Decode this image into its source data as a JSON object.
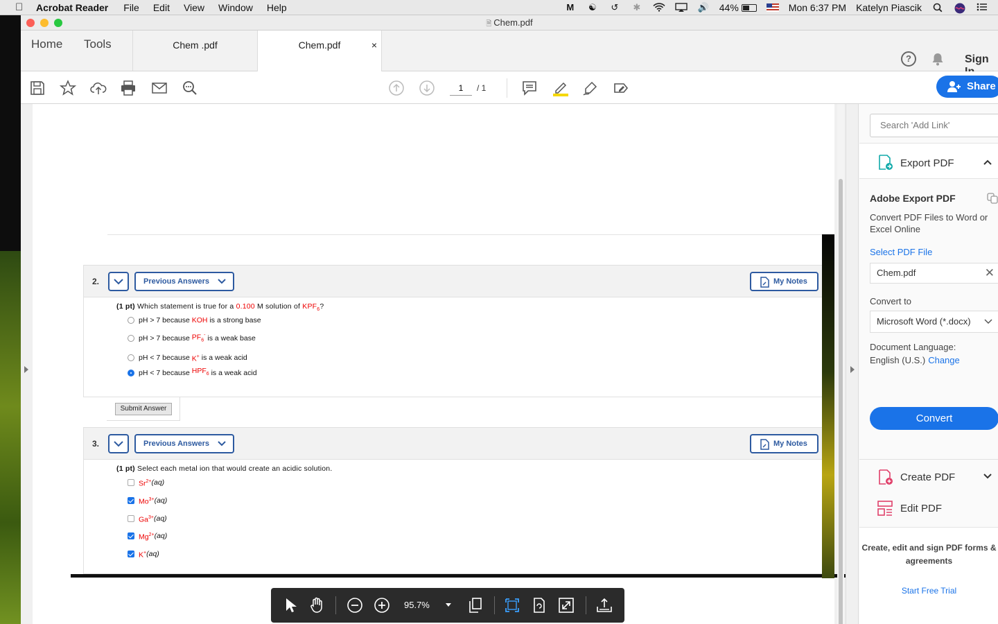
{
  "menubar": {
    "app_name": "Acrobat Reader",
    "menus": [
      "File",
      "Edit",
      "View",
      "Window",
      "Help"
    ],
    "battery": "44%",
    "clock": "Mon 6:37 PM",
    "user": "Katelyn Piascik"
  },
  "window": {
    "title": "Chem.pdf"
  },
  "tabs": {
    "home": "Home",
    "tools": "Tools",
    "doc_tabs": [
      {
        "label": "Chem .pdf"
      },
      {
        "label": "Chem.pdf",
        "close": "×"
      }
    ],
    "help": "?",
    "signin": "Sign In"
  },
  "toolbar": {
    "page_current": "1",
    "page_total": "/ 1",
    "share": "Share"
  },
  "questions": {
    "q2": {
      "number": "2.",
      "prev_answers": "Previous Answers",
      "my_notes": "My Notes",
      "points": "(1 pt)",
      "text_a": "Which statement is true for a",
      "conc": "0.100",
      "text_b": "M solution of",
      "compound": "KPF",
      "compound_sub": "6",
      "q_end": "?",
      "options": [
        {
          "a": "pH > 7 because",
          "r": "KOH",
          "b": "is a strong base",
          "selected": false
        },
        {
          "a": "pH > 7 because",
          "r": "PF",
          "sub": "6",
          "sup": "-",
          "b": "is a weak base",
          "selected": false
        },
        {
          "a": "pH < 7 because",
          "r": "K",
          "sup": "+",
          "b": "is a weak acid",
          "selected": false
        },
        {
          "a": "pH < 7 because",
          "r": "HPF",
          "sub": "6",
          "b": "is a weak acid",
          "selected": true
        }
      ],
      "submit": "Submit Answer"
    },
    "q3": {
      "number": "3.",
      "prev_answers": "Previous Answers",
      "my_notes": "My Notes",
      "points": "(1 pt)",
      "text": "Select each metal ion that would create an acidic solution.",
      "options": [
        {
          "ion": "Sr",
          "charge": "2+",
          "state": "(aq)",
          "checked": false
        },
        {
          "ion": "Mo",
          "charge": "3+",
          "state": "(aq)",
          "checked": true
        },
        {
          "ion": "Ga",
          "charge": "3+",
          "state": "(aq)",
          "checked": false
        },
        {
          "ion": "Mg",
          "charge": "2+",
          "state": "(aq)",
          "checked": true
        },
        {
          "ion": "K",
          "charge": "+",
          "state": "(aq)",
          "checked": true
        }
      ]
    }
  },
  "floatbar": {
    "zoom": "95.7%"
  },
  "rpanel": {
    "search_placeholder": "Search 'Add Link'",
    "export_pdf": "Export PDF",
    "aep_title": "Adobe Export PDF",
    "aep_desc": "Convert PDF Files to Word or Excel Online",
    "select_file": "Select PDF File",
    "file_name": "Chem.pdf",
    "convert_to": "Convert to",
    "convert_option": "Microsoft Word (*.docx)",
    "doc_lang_label": "Document Language:",
    "doc_lang": "English (U.S.)",
    "change": "Change",
    "convert_btn": "Convert",
    "create_pdf": "Create PDF",
    "edit_pdf": "Edit PDF",
    "promo_text": "Create, edit and sign PDF forms & agreements",
    "trial": "Start Free Trial"
  },
  "colors": {
    "accent": "#1a73e8",
    "question_blue": "#2d5aa0",
    "chem_red": "#e00000"
  }
}
